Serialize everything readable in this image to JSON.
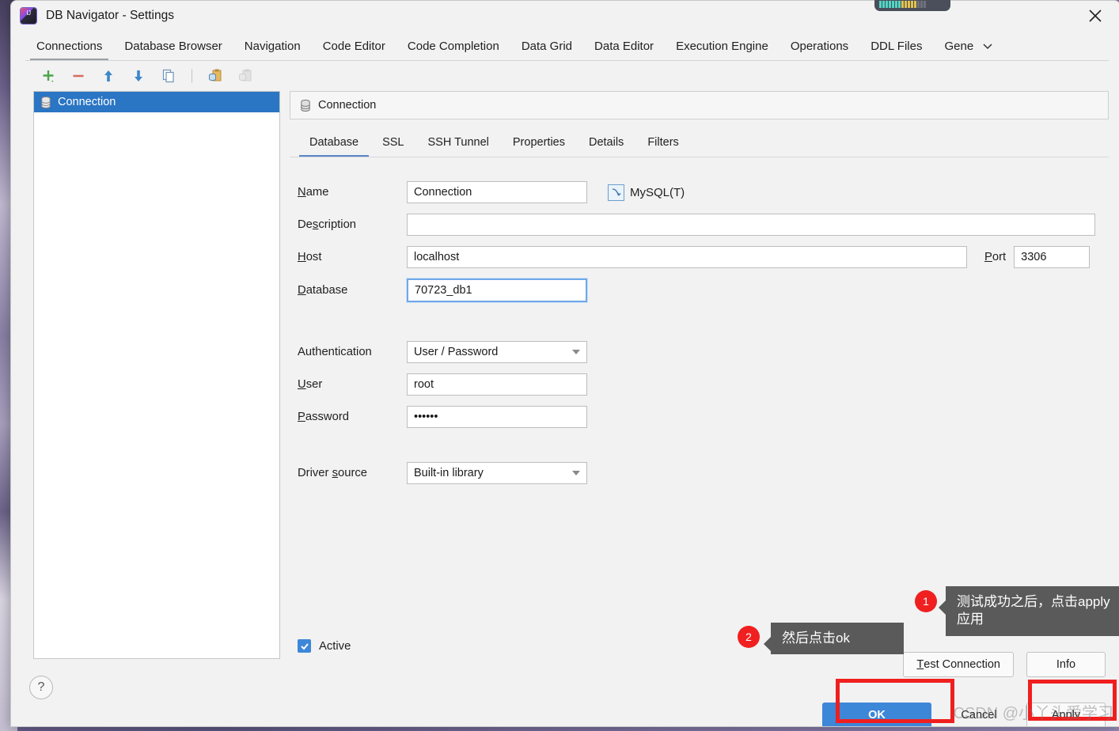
{
  "window": {
    "title": "DB Navigator - Settings",
    "app_icon": "intellij-idea-icon",
    "close_icon": "close-icon"
  },
  "main_tabs": [
    {
      "label": "Connections",
      "active": true
    },
    {
      "label": "Database Browser",
      "active": false
    },
    {
      "label": "Navigation",
      "active": false
    },
    {
      "label": "Code Editor",
      "active": false
    },
    {
      "label": "Code Completion",
      "active": false
    },
    {
      "label": "Data Grid",
      "active": false
    },
    {
      "label": "Data Editor",
      "active": false
    },
    {
      "label": "Execution Engine",
      "active": false
    },
    {
      "label": "Operations",
      "active": false
    },
    {
      "label": "DDL Files",
      "active": false
    },
    {
      "label": "Gene",
      "active": false
    }
  ],
  "toolbar": {
    "buttons": [
      {
        "name": "add-connection-button",
        "icon": "plus-icon"
      },
      {
        "name": "remove-connection-button",
        "icon": "minus-icon"
      },
      {
        "name": "move-up-button",
        "icon": "arrow-up-icon"
      },
      {
        "name": "move-down-button",
        "icon": "arrow-down-icon"
      },
      {
        "name": "duplicate-button",
        "icon": "copy-icon"
      },
      {
        "name": "copy-connection-button",
        "icon": "clipboard-database-copy-icon"
      },
      {
        "name": "paste-connection-button",
        "icon": "clipboard-database-paste-icon"
      }
    ]
  },
  "sidebar": {
    "items": [
      {
        "label": "Connection",
        "icon": "database-icon",
        "selected": true
      }
    ]
  },
  "pane": {
    "header_title": "Connection",
    "header_icon": "database-icon",
    "sub_tabs": [
      {
        "label": "Database",
        "active": true
      },
      {
        "label": "SSL",
        "active": false
      },
      {
        "label": "SSH Tunnel",
        "active": false
      },
      {
        "label": "Properties",
        "active": false
      },
      {
        "label": "Details",
        "active": false
      },
      {
        "label": "Filters",
        "active": false
      }
    ]
  },
  "form": {
    "name": {
      "label_pre": "",
      "label_mnemonic": "N",
      "label_post": "ame",
      "value": "Connection",
      "placeholder": ""
    },
    "driver_tag": {
      "label": "MySQL(T)",
      "icon": "mysql-dolphin-icon"
    },
    "description": {
      "label_pre": "De",
      "label_mnemonic": "s",
      "label_post": "cription",
      "value": "",
      "placeholder": ""
    },
    "host": {
      "label_pre": "",
      "label_mnemonic": "H",
      "label_post": "ost",
      "value": "localhost",
      "placeholder": ""
    },
    "port": {
      "label_pre": "",
      "label_mnemonic": "P",
      "label_post": "ort",
      "value": "3306",
      "placeholder": ""
    },
    "database": {
      "label_pre": "",
      "label_mnemonic": "D",
      "label_post": "atabase",
      "value": "70723_db1",
      "placeholder": "",
      "focused": true
    },
    "authentication": {
      "label": "Authentication",
      "value": "User / Password",
      "options": [
        "User / Password"
      ]
    },
    "user": {
      "label_pre": "",
      "label_mnemonic": "U",
      "label_post": "ser",
      "value": "root",
      "placeholder": ""
    },
    "password": {
      "label_pre": "",
      "label_mnemonic": "P",
      "label_post": "assword",
      "value": "••••••",
      "placeholder": ""
    },
    "driver_source": {
      "label_pre": "Driver ",
      "label_mnemonic": "s",
      "label_post": "ource",
      "value": "Built-in library",
      "options": [
        "Built-in library"
      ]
    },
    "active": {
      "label": "Active",
      "checked": true,
      "check_glyph": "✓"
    }
  },
  "buttons": {
    "test_connection": {
      "pre": "",
      "mnemonic": "T",
      "post": "est Connection"
    },
    "info": "Info",
    "ok": "OK",
    "cancel": "Cancel",
    "apply": "Apply",
    "help": "?"
  },
  "callouts": [
    {
      "number": "1",
      "text": "测试成功之后，点击apply应用"
    },
    {
      "number": "2",
      "text": "然后点击ok"
    }
  ],
  "watermark": "CSDN @小丫头爱学习",
  "colors": {
    "accent_blue": "#3d87d8",
    "selection_blue": "#2a75c4",
    "highlight_red": "#f01f1f",
    "callout_gray": "#5a5a5a",
    "window_bg": "#f2f2f2"
  }
}
